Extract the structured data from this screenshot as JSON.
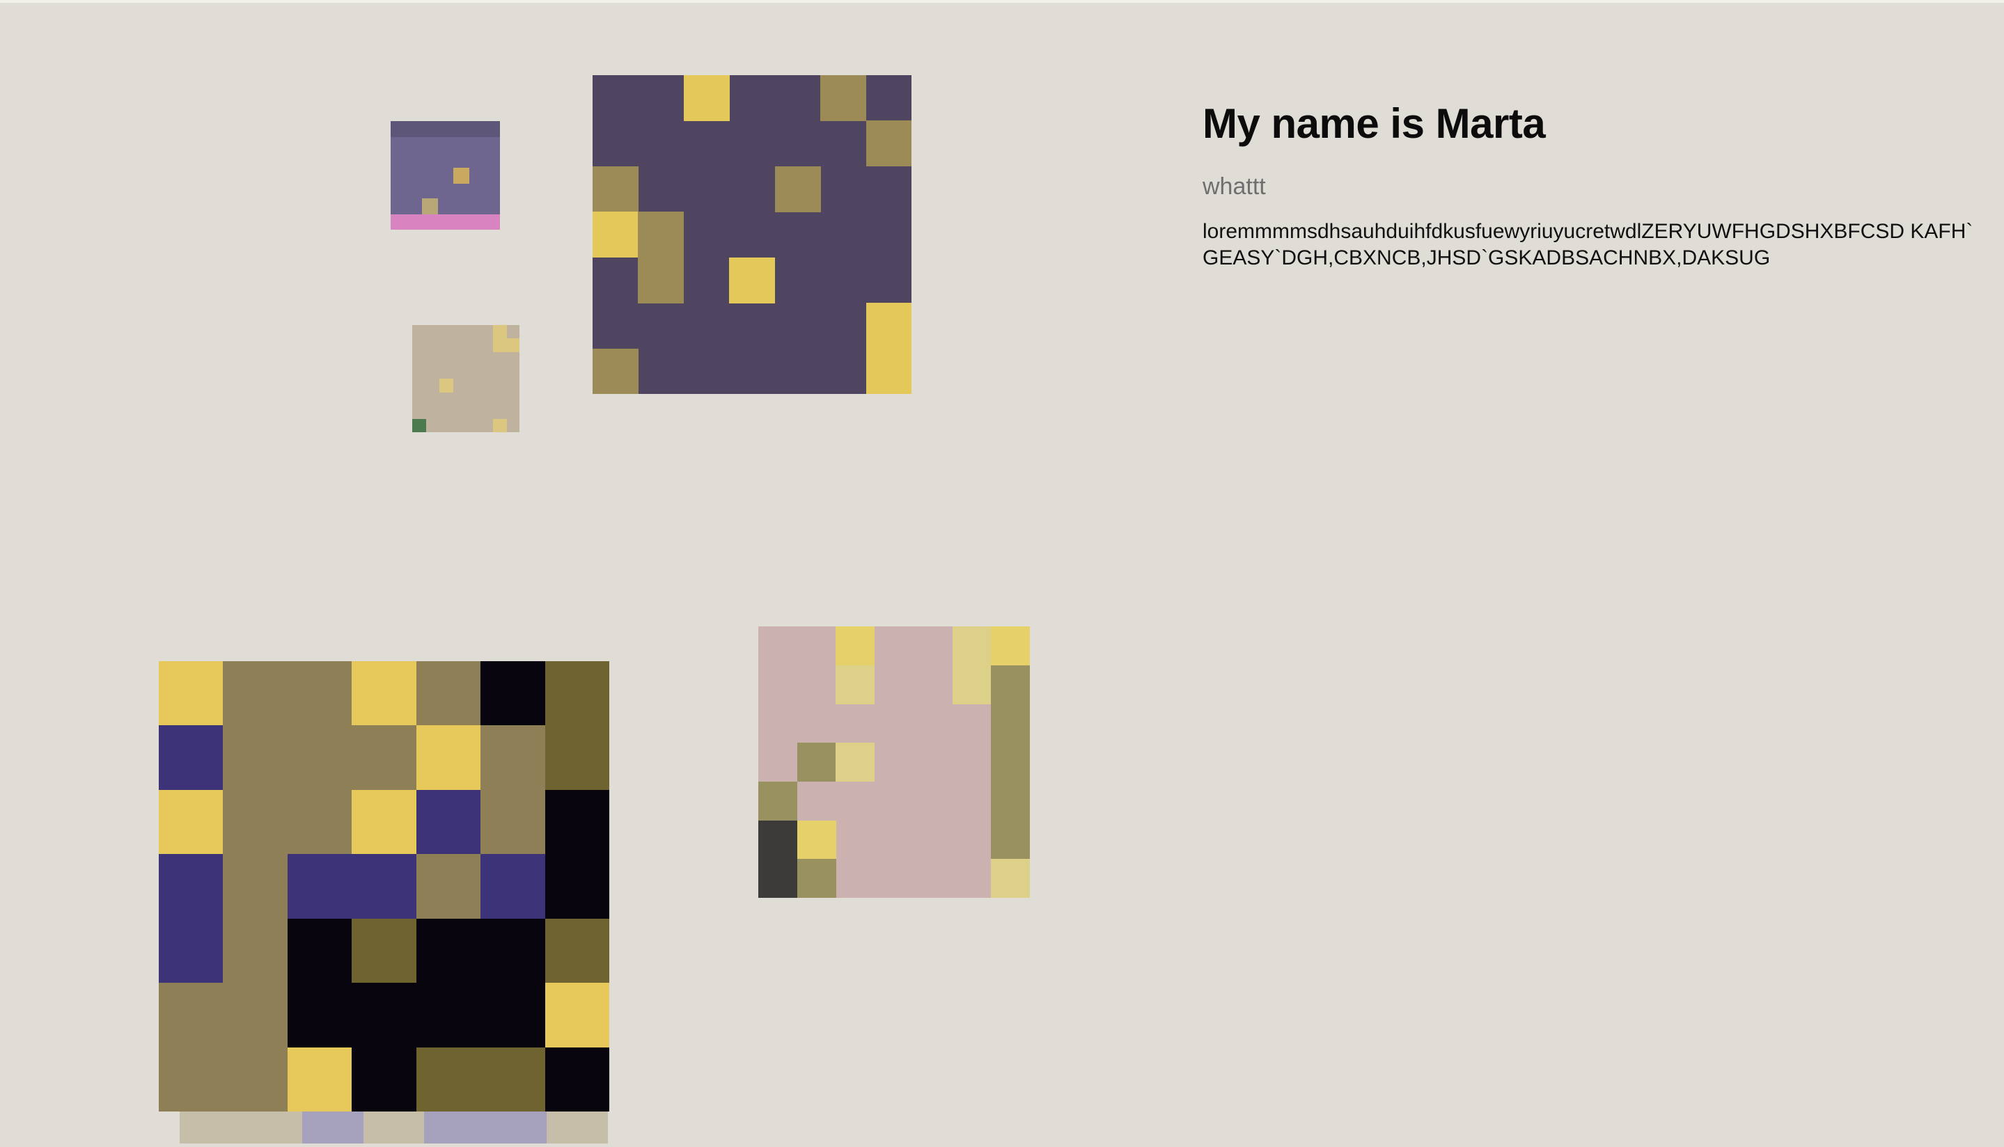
{
  "profile": {
    "title": "My name is Marta",
    "subtitle": "whattt",
    "body": "loremmmmsdhsauhduihfdkusfuewyriuyucretwdlZERYUWFHGDSHXBFCSD KAFH`GEASY`DGH,CBXNCB,JHSD`GSKADBSACHNBX,DAKSUG"
  },
  "gallery": {
    "tiles": [
      {
        "name": "pixel-tile-small-purple",
        "colors": {
          "base": "#6f6690",
          "accent": "#c9a860",
          "stripe": "#d884c0"
        }
      },
      {
        "name": "pixel-tile-large-purple",
        "colors": {
          "base": "#4f4560",
          "accent": "#e4c95a",
          "muted": "#9c8b56"
        }
      },
      {
        "name": "pixel-tile-small-beige",
        "colors": {
          "base": "#bfb29f",
          "accent": "#dbc77f"
        }
      },
      {
        "name": "pixel-tile-large-dark",
        "colors": {
          "olive": "#8f7f57",
          "yellow": "#e6c95a",
          "indigo": "#3c3378",
          "black": "#08050f",
          "khaki": "#6f6330"
        }
      },
      {
        "name": "pixel-tile-photo-pink",
        "colors": {
          "base": "#cbb2b0",
          "accent": "#e6d06a",
          "dark": "#3c3b3a",
          "olive": "#9a9160"
        }
      }
    ]
  }
}
